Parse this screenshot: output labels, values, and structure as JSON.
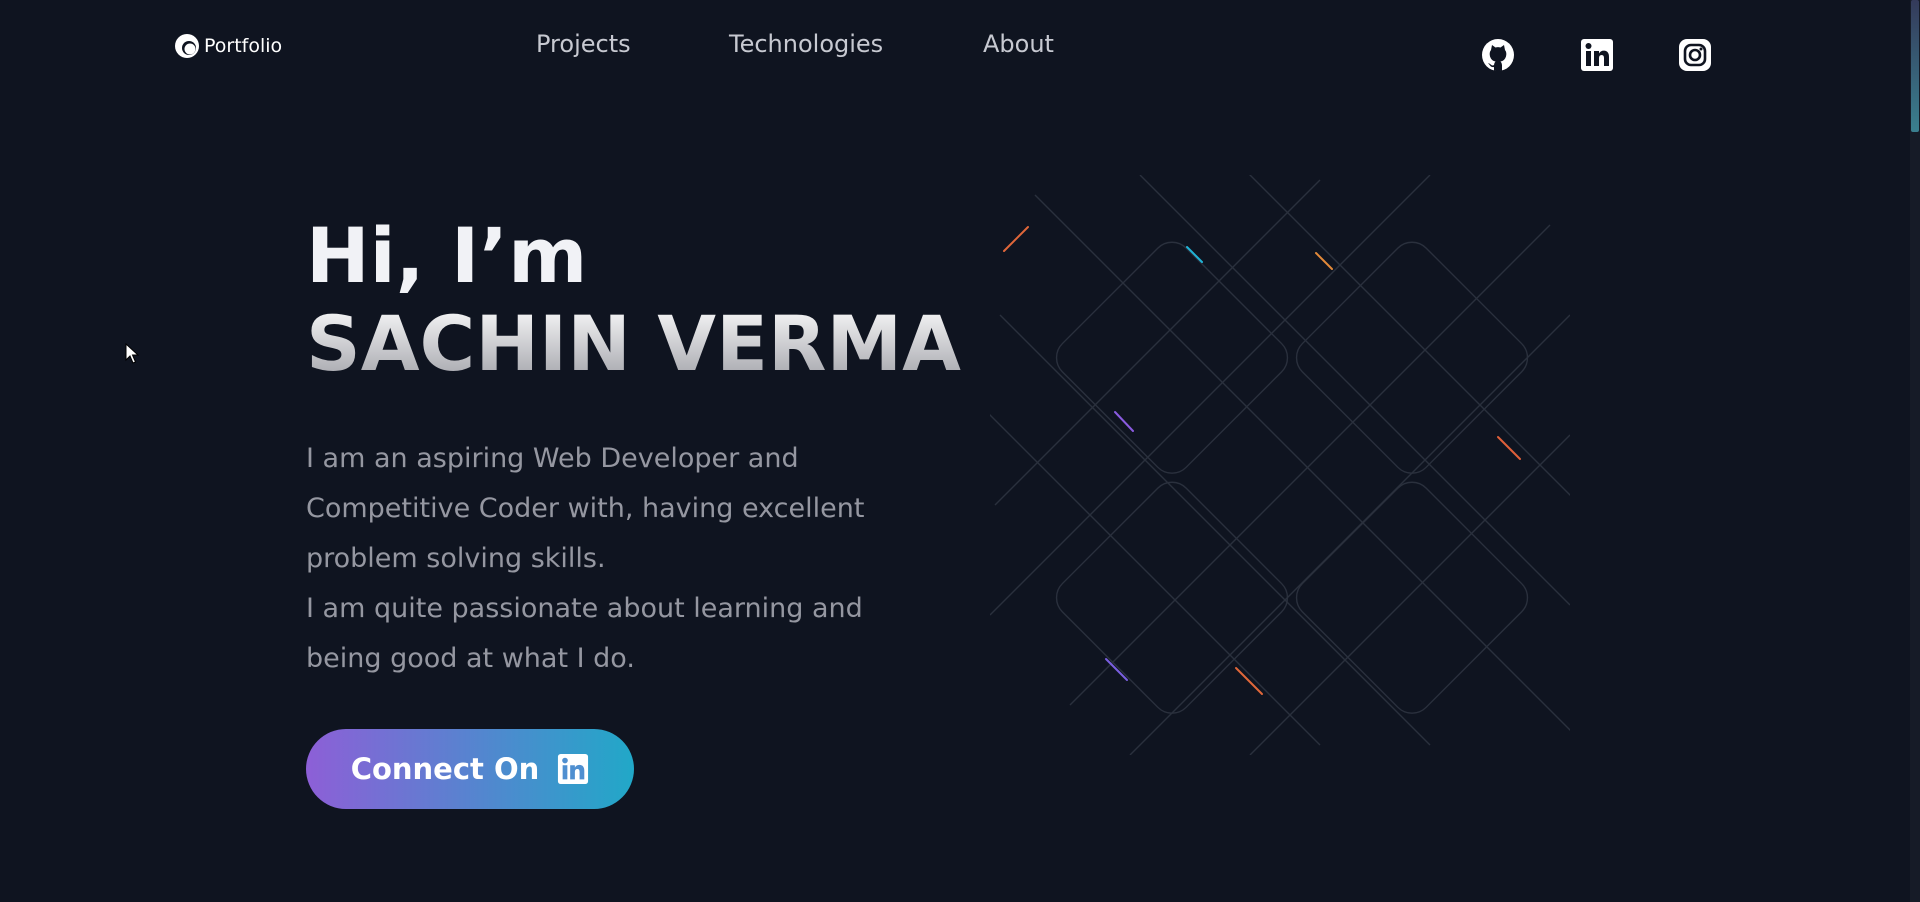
{
  "header": {
    "brand_label": "Portfolio",
    "brand_icon": "logo-circle-icon",
    "nav": [
      {
        "label": "Projects"
      },
      {
        "label": "Technologies"
      },
      {
        "label": "About"
      }
    ],
    "socials": [
      {
        "icon": "github-icon"
      },
      {
        "icon": "linkedin-icon"
      },
      {
        "icon": "instagram-icon"
      }
    ]
  },
  "hero": {
    "greeting": "Hi, I’m",
    "name": "SACHIN VERMA",
    "description_lines": [
      "I am an aspiring Web Developer and",
      "Competitive Coder with, having excellent",
      "problem solving skills.",
      "I am quite passionate about learning and",
      "being good at what I do."
    ],
    "cta_label": "Connect On",
    "cta_icon": "linkedin-icon"
  },
  "colors": {
    "background": "#0f1420",
    "nav_text": "#c7c9d1",
    "body_text": "#9597a1",
    "cta_gradient_start": "#8d5fd7",
    "cta_gradient_end": "#21a8c8"
  }
}
